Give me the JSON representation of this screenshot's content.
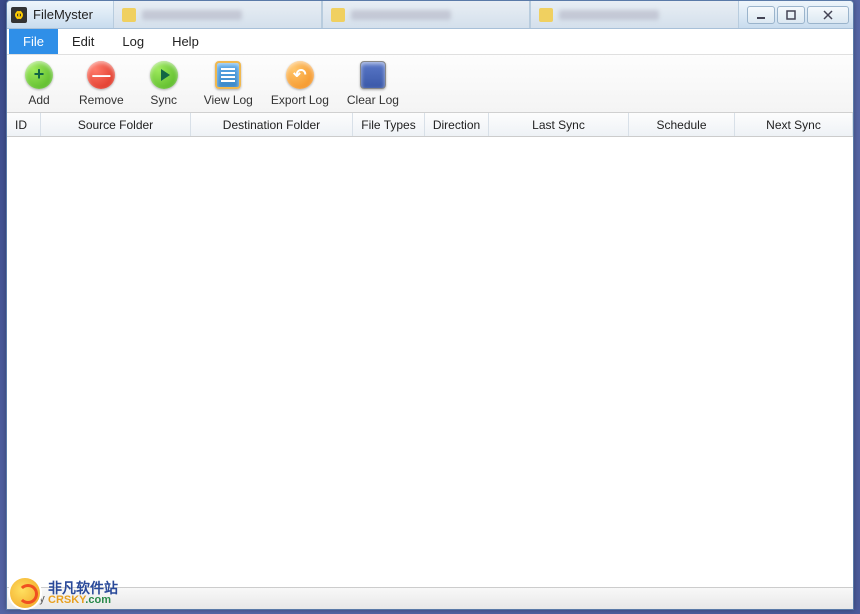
{
  "title": "FileMyster",
  "menu": {
    "file": "File",
    "edit": "Edit",
    "log": "Log",
    "help": "Help"
  },
  "toolbar": {
    "add": "Add",
    "remove": "Remove",
    "sync": "Sync",
    "viewlog": "View Log",
    "exportlog": "Export Log",
    "clearlog": "Clear Log"
  },
  "columns": {
    "id": "ID",
    "source": "Source Folder",
    "destination": "Destination Folder",
    "filetypes": "File Types",
    "direction": "Direction",
    "lastsync": "Last Sync",
    "schedule": "Schedule",
    "nextsync": "Next Sync"
  },
  "status": "Ready",
  "watermark": {
    "cn": "非凡软件站",
    "en_a": "CRSKY",
    "en_b": ".com"
  }
}
